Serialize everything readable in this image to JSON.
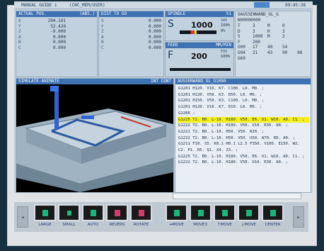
{
  "titlebar": {
    "mode": "MANUAL GUIDE i",
    "program_path": "(CNC_MEM/USER)",
    "time": "09:45:38",
    "mode_color": "#4a86c9"
  },
  "actual_pos": {
    "title": "ACTUAL POS.",
    "coord": "(ABS.)",
    "axes": [
      "X",
      "Y",
      "Z",
      "A",
      "B",
      "C"
    ],
    "values": [
      "204.191",
      "52.420",
      "-9.000",
      "0.000",
      "0.000",
      "0.000"
    ]
  },
  "dist_to_go": {
    "title": "DIST TO GO",
    "axes": [
      "X",
      "Y",
      "Z",
      "A",
      "B",
      "C"
    ],
    "values": [
      "0.000",
      "0.000",
      "0.000",
      "0.000",
      "0.000",
      "0.000"
    ]
  },
  "spindle": {
    "title": "SPINDLE",
    "id": "S1",
    "letter": "S",
    "value": "1000",
    "sov_label": "SOV",
    "sov_value": "100%",
    "load_value": "0%"
  },
  "feed": {
    "title": "FEED",
    "unit": "MM/MIN",
    "letter": "F",
    "value": "200",
    "fov_label": "FOV",
    "fov_value": "100%"
  },
  "program_info": {
    "name": "OAUSSENWAND_GL_G",
    "number": "N00000000",
    "codes": [
      [
        "T",
        "3",
        "M",
        "0"
      ],
      [
        "D",
        "3",
        "H",
        "3"
      ],
      [
        "S",
        "1000",
        "M",
        "3"
      ],
      [
        "F",
        "200",
        "",
        ""
      ],
      [
        "G00",
        "17",
        "40",
        "54"
      ],
      [
        "G94",
        "21",
        "43",
        "90",
        "98"
      ],
      [
        "G69",
        "",
        "",
        ""
      ]
    ]
  },
  "simulate": {
    "title": "SIMULATE-ANIMATE",
    "tag": "INT CONT"
  },
  "program_list": {
    "title": "AUSSENWAND_GL_G1080",
    "lines": [
      "G1201 H120. V10. K7. C100. L0. M0. ;",
      "G1201 H120. V50. K3. D50. L0. M0. ;",
      "G1201 H150. V50. K3. C100. L0. M0. ;",
      "G1201 H120. V10. K7. D10. L0. M0. ;",
      "G1206 ;",
      "G1225 T2. B0. L-10. H180. V50. E6. U1. W10. A0. C1. ;",
      "G1222 T2. B0. L-10. H180. V50. U10. R30. A0. ;",
      "G1221 T2. B0. L-10. H50. V50. R20. ;",
      "G1222 T2. B0. L-10. H50. V50. U50. W70. R0. A0. ;",
      "G1211 F10. S5. K0.1 H0.1 L2.5 F350. V100. E150. W2.",
      "C2. P1. R5. Q1. X4. Z3. ;",
      "G1225 T2. B0. L-10. H180. V50. E6. U1. W10. A0. C1. ;",
      "G1222 T2. B0. L-10. H180. V50. U10. R30. A0. ;"
    ],
    "highlight_index": 5,
    "highlight_color": "#f5f01a"
  },
  "softkeys": [
    {
      "label": "LARGE",
      "icon": "zoom-in-icon"
    },
    {
      "label": "SMALL",
      "icon": "zoom-out-icon"
    },
    {
      "label": "AUTO",
      "icon": "auto-fit-icon"
    },
    {
      "label": "REVERS",
      "icon": "reverse-icon"
    },
    {
      "label": "ROTATE",
      "icon": "rotate-icon"
    },
    {
      "label": "↔MOVE",
      "icon": "move-horizontal-icon"
    },
    {
      "label": "MOVE↕",
      "icon": "move-vertical-icon"
    },
    {
      "label": "↑MOVE",
      "icon": "move-up-icon"
    },
    {
      "label": "↓MOVE",
      "icon": "move-down-icon"
    },
    {
      "label": "CENTER",
      "icon": "center-icon"
    }
  ],
  "nav": {
    "left": "◂",
    "right": "▸"
  }
}
